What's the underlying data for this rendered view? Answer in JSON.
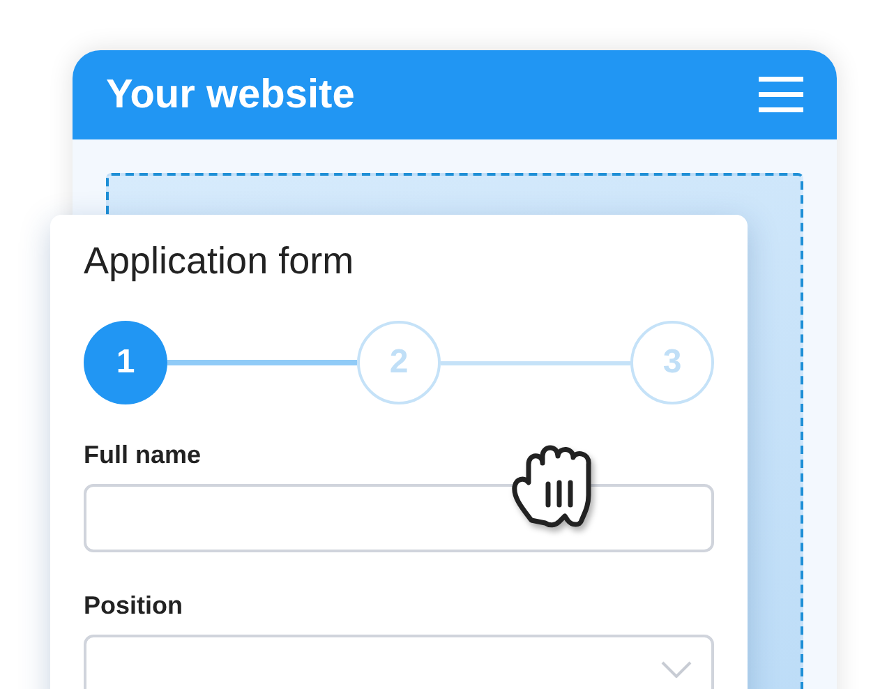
{
  "header": {
    "title": "Your website"
  },
  "form": {
    "title": "Application form",
    "steps": [
      {
        "label": "1",
        "selected": true
      },
      {
        "label": "2",
        "selected": false
      },
      {
        "label": "3",
        "selected": false
      }
    ],
    "fields": [
      {
        "label": "Full name",
        "kind": "text"
      },
      {
        "label": "Position",
        "kind": "select"
      }
    ]
  }
}
